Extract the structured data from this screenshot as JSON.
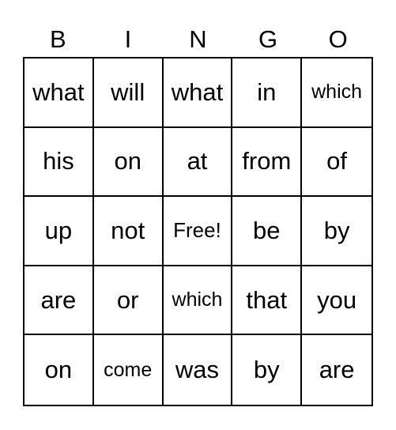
{
  "header": [
    "B",
    "I",
    "N",
    "G",
    "O"
  ],
  "rows": [
    [
      "what",
      "will",
      "what",
      "in",
      "which"
    ],
    [
      "his",
      "on",
      "at",
      "from",
      "of"
    ],
    [
      "up",
      "not",
      "Free!",
      "be",
      "by"
    ],
    [
      "are",
      "or",
      "which",
      "that",
      "you"
    ],
    [
      "on",
      "come",
      "was",
      "by",
      "are"
    ]
  ]
}
